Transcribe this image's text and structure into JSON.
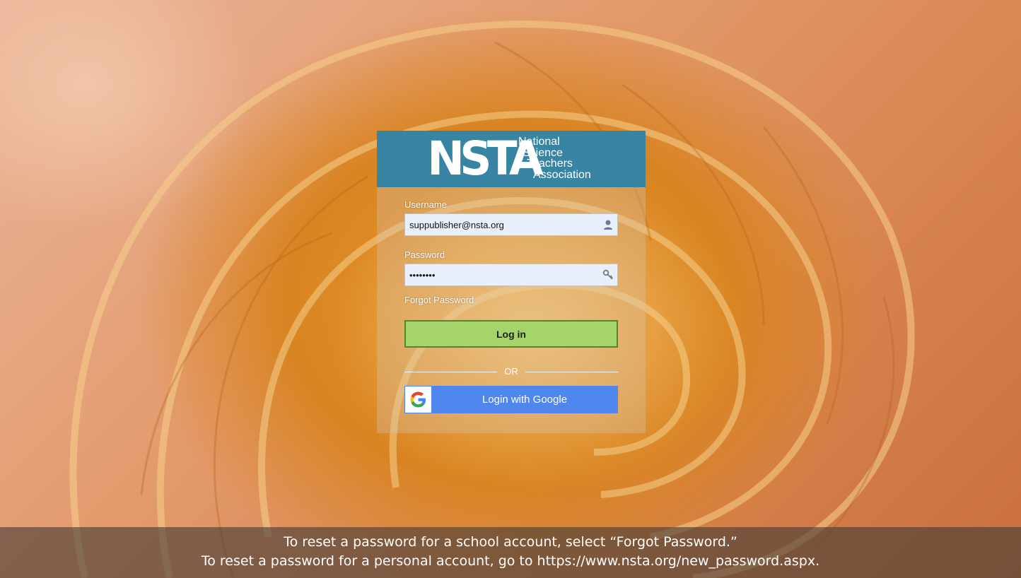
{
  "logo": {
    "mark": "NSTA",
    "words": [
      "National",
      "Science",
      "Teachers",
      "Association"
    ]
  },
  "login_form": {
    "username_label": "Username",
    "username_value": "suppublisher@nsta.org",
    "password_label": "Password",
    "password_value": "password",
    "forgot_label": "Forgot Password",
    "login_button": "Log in",
    "divider_text": "OR",
    "google_button": "Login with Google"
  },
  "footer": {
    "line1": "To reset a password for a school account, select “Forgot Password.”",
    "line2": "To reset a password for a personal account, go to https://www.nsta.org/new_password.aspx."
  },
  "colors": {
    "logo_bar": "#3784a3",
    "login_button": "#a5d46a",
    "google_button": "#5087ee",
    "input_bg": "#e8f0fe"
  },
  "icons": {
    "username": "user-icon",
    "password": "key-icon",
    "google": "google-g-icon"
  }
}
